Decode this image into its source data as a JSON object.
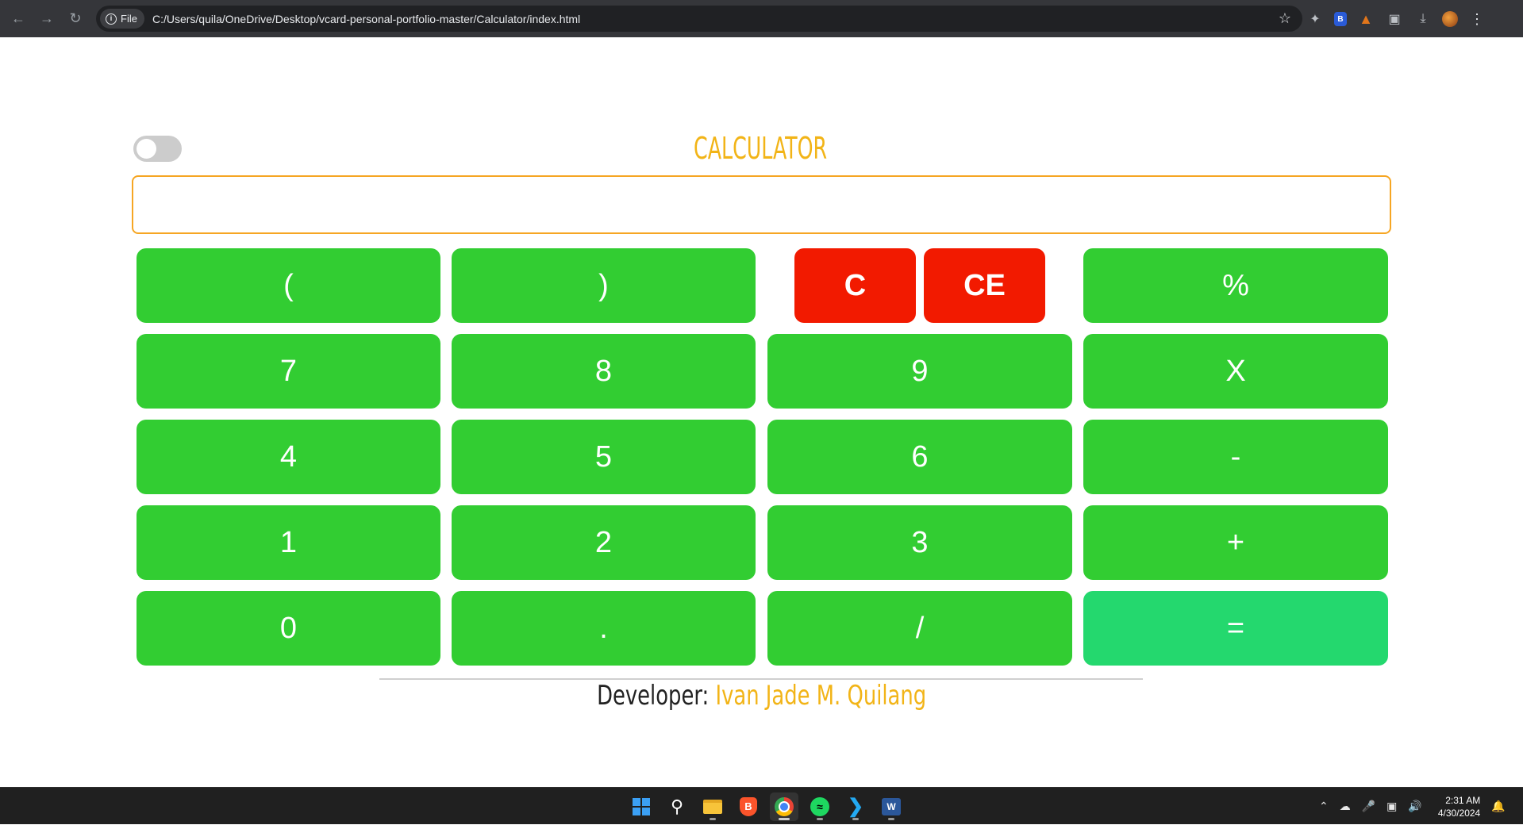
{
  "browser": {
    "back_icon": "back-arrow-icon",
    "forward_icon": "forward-arrow-icon",
    "reload_icon": "reload-icon",
    "file_chip": "File",
    "url": "C:/Users/quila/OneDrive/Desktop/vcard-personal-portfolio-master/Calculator/index.html"
  },
  "calculator": {
    "title": "CALCULATOR",
    "display_value": "",
    "keys": {
      "open_paren": "(",
      "close_paren": ")",
      "clear": "C",
      "clear_entry": "CE",
      "percent": "%",
      "seven": "7",
      "eight": "8",
      "nine": "9",
      "multiply": "X",
      "four": "4",
      "five": "5",
      "six": "6",
      "minus": "-",
      "one": "1",
      "two": "2",
      "three": "3",
      "plus": "+",
      "zero": "0",
      "dot": ".",
      "divide": "/",
      "equals": "="
    },
    "colors": {
      "accent": "#f2b417",
      "key_green": "#32cd32",
      "key_red": "#f21a00",
      "key_equals": "#24d86e"
    }
  },
  "footer": {
    "label": "Developer:",
    "name": "Ivan Jade M. Quilang"
  },
  "taskbar": {
    "time": "2:31 AM",
    "date": "4/30/2024"
  }
}
